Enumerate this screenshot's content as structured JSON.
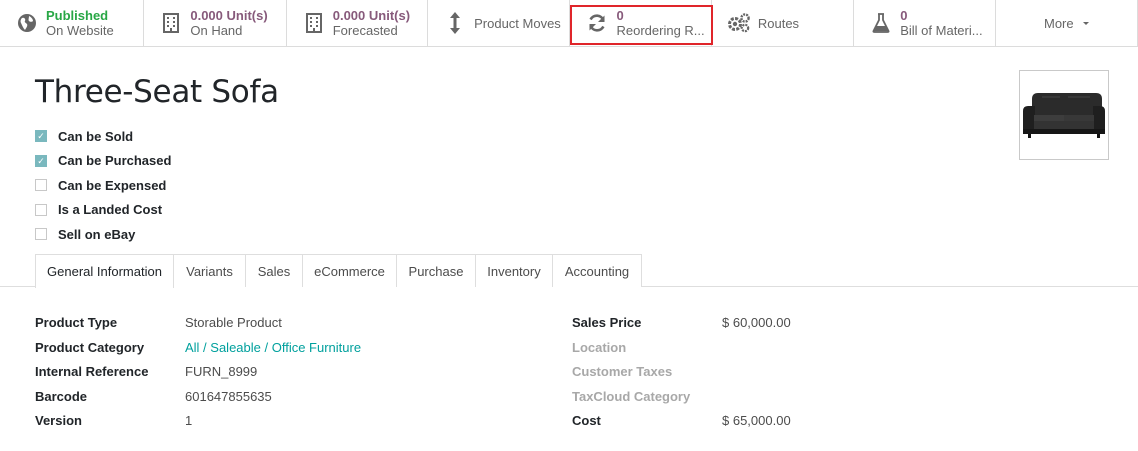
{
  "smart_buttons": [
    {
      "value": "Published",
      "label": "On Website",
      "icon": "globe-icon",
      "name": "published-button"
    },
    {
      "value": "0.000 Unit(s)",
      "label": "On Hand",
      "icon": "building-icon",
      "name": "on-hand-button"
    },
    {
      "value": "0.000 Unit(s)",
      "label": "Forecasted",
      "icon": "building-icon",
      "name": "forecasted-button"
    },
    {
      "label": "Product Moves",
      "icon": "vertical-arrows-icon",
      "name": "product-moves-button"
    },
    {
      "value": "0",
      "label": "Reordering R...",
      "icon": "refresh-icon",
      "name": "reordering-rules-button"
    },
    {
      "label": "Routes",
      "icon": "gears-icon",
      "name": "routes-button"
    },
    {
      "value": "0",
      "label": "Bill of Materi...",
      "icon": "flask-icon",
      "name": "bill-of-materials-button"
    },
    {
      "label": "More",
      "icon": "caret-down-icon",
      "name": "more-button"
    }
  ],
  "product": {
    "name": "Three-Seat Sofa",
    "image_icon": "sofa-image"
  },
  "checkboxes": [
    {
      "label": "Can be Sold",
      "checked": true
    },
    {
      "label": "Can be Purchased",
      "checked": true
    },
    {
      "label": "Can be Expensed",
      "checked": false
    },
    {
      "label": "Is a Landed Cost",
      "checked": false
    },
    {
      "label": "Sell on eBay",
      "checked": false
    }
  ],
  "tabs": [
    "General Information",
    "Variants",
    "Sales",
    "eCommerce",
    "Purchase",
    "Inventory",
    "Accounting"
  ],
  "active_tab": "General Information",
  "left_fields": [
    {
      "label": "Product Type",
      "value": "Storable Product"
    },
    {
      "label": "Product Category",
      "value": "All / Saleable / Office Furniture"
    },
    {
      "label": "Internal Reference",
      "value": "FURN_8999"
    },
    {
      "label": "Barcode",
      "value": "601647855635"
    },
    {
      "label": "Version",
      "value": "1"
    }
  ],
  "right_fields": [
    {
      "label": "Sales Price",
      "value": "$ 60,000.00"
    },
    {
      "label": "Location",
      "value": ""
    },
    {
      "label": "Customer Taxes",
      "value": ""
    },
    {
      "label": "TaxCloud Category",
      "value": ""
    },
    {
      "label": "Cost",
      "value": "$ 65,000.00"
    }
  ],
  "colors": {
    "accent": "#875a7b",
    "published": "#28a745",
    "link": "#00a09d",
    "highlight_border": "#e0252a",
    "checkbox_on": "#7ab8be"
  }
}
